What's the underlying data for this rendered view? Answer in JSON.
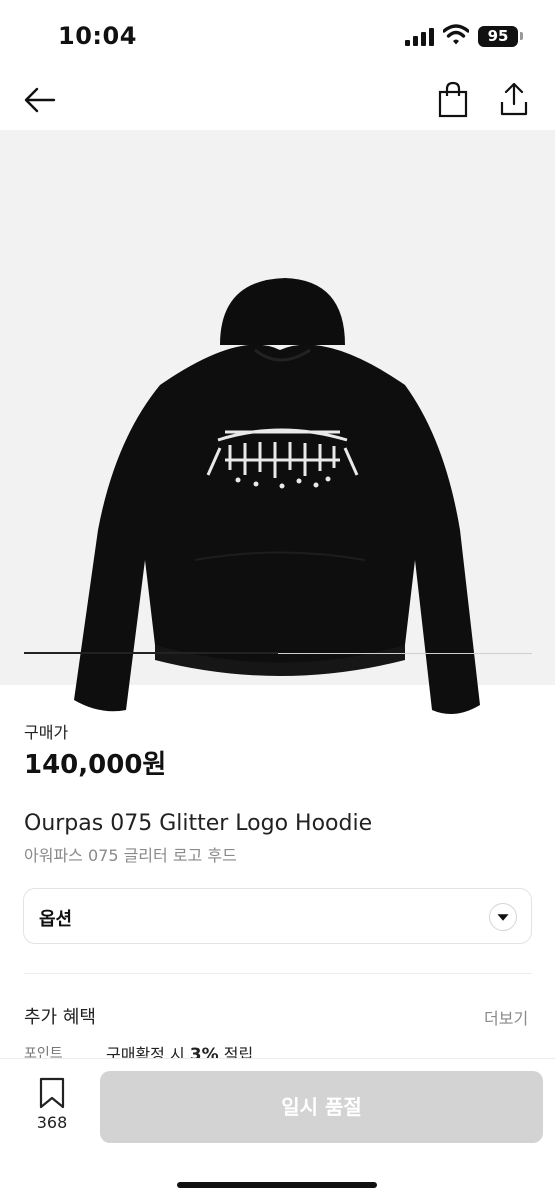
{
  "status_bar": {
    "time": "10:04",
    "battery": "95"
  },
  "product": {
    "progress": 0.5,
    "price_label": "구매가",
    "price": "140,000원",
    "name_en": "Ourpas 075 Glitter Logo Hoodie",
    "name_ko": "아워파스 075 글리터 로고 후드",
    "option_label": "옵션"
  },
  "benefits": {
    "title": "추가 혜택",
    "more": "더보기",
    "point_label": "포인트",
    "point_prefix": "구매확정 시 ",
    "point_rate": "3%",
    "point_suffix": " 적립"
  },
  "bottom_bar": {
    "bookmark_count": "368",
    "button_label": "일시 품절"
  },
  "colors": {
    "disabled_button": "#d3d3d3",
    "image_bg": "#f2f2f2"
  },
  "icons": [
    "back-arrow-icon",
    "shopping-bag-icon",
    "share-icon",
    "dropdown-icon",
    "bookmark-icon"
  ]
}
